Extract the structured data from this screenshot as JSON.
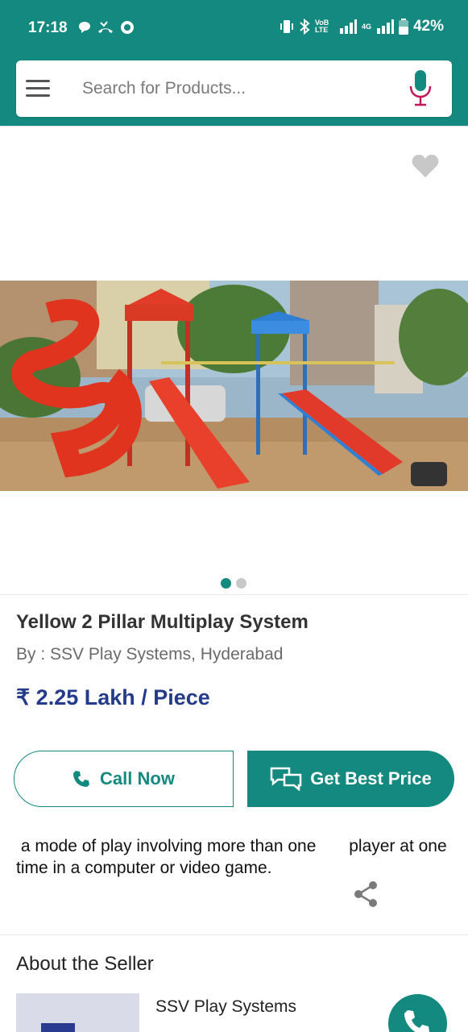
{
  "status_bar": {
    "time": "17:18",
    "battery": "42%",
    "net_volte": "VoB LTE",
    "net_4g": "4G"
  },
  "search": {
    "placeholder": "Search for Products..."
  },
  "product": {
    "title": "Yellow 2 Pillar Multiplay System",
    "by": "By : SSV Play Systems, Hyderabad",
    "price": "₹ 2.25 Lakh / Piece",
    "image_count": 2,
    "active_image": 1
  },
  "actions": {
    "call_now": "Call Now",
    "get_best_price": "Get Best Price"
  },
  "description": " a mode of play involving more than one       player at one time in a computer or video game.",
  "seller": {
    "section_title": "About the Seller",
    "name": "SSV Play Systems"
  },
  "colors": {
    "brand": "#14897f",
    "price": "#233b8a",
    "mic": "#c2185b"
  }
}
